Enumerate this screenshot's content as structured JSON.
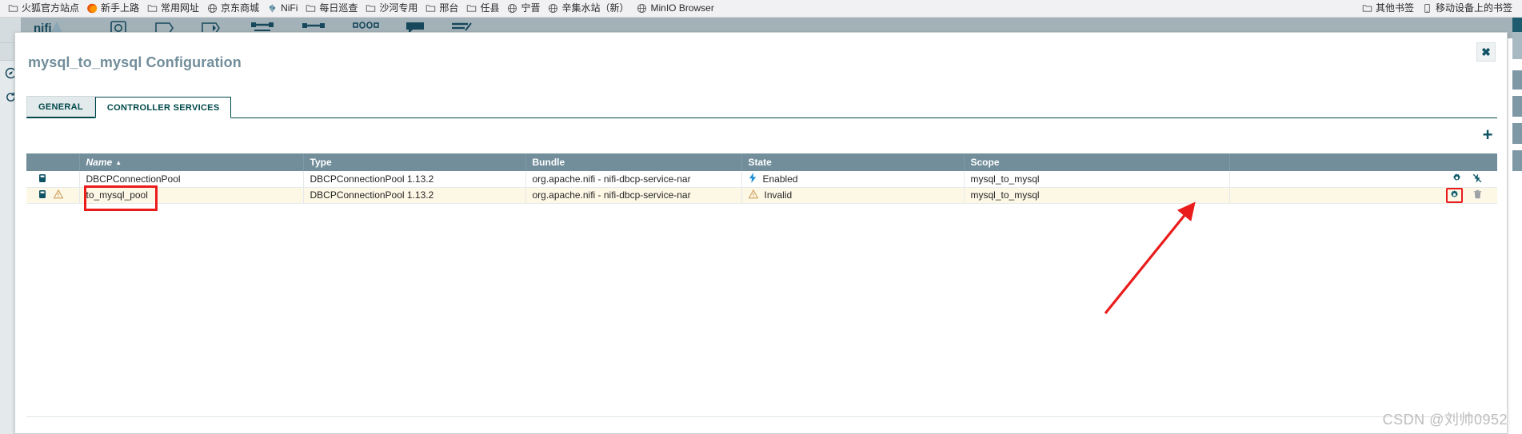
{
  "browser": {
    "bookmarks": [
      {
        "icon": "folder-icon",
        "label": "火狐官方站点"
      },
      {
        "icon": "firefox-icon",
        "label": "新手上路"
      },
      {
        "icon": "folder-icon",
        "label": "常用网址"
      },
      {
        "icon": "globe-icon",
        "label": "京东商城"
      },
      {
        "icon": "nifi-icon",
        "label": "NiFi"
      },
      {
        "icon": "folder-icon",
        "label": "每日巡查"
      },
      {
        "icon": "folder-icon",
        "label": "沙河专用"
      },
      {
        "icon": "folder-icon",
        "label": "邢台"
      },
      {
        "icon": "folder-icon",
        "label": "任县"
      },
      {
        "icon": "globe-icon",
        "label": "宁晋"
      },
      {
        "icon": "globe-icon",
        "label": "辛集水站（新）"
      },
      {
        "icon": "globe-icon",
        "label": "MinIO Browser"
      }
    ],
    "right_bookmarks": [
      {
        "icon": "folder-icon",
        "label": "其他书签"
      },
      {
        "icon": "mobile-icon",
        "label": "移动设备上的书签"
      }
    ]
  },
  "dialog": {
    "title": "mysql_to_mysql Configuration",
    "close_label": "✖",
    "tabs": [
      {
        "label": "GENERAL",
        "active": false
      },
      {
        "label": "CONTROLLER SERVICES",
        "active": true
      }
    ],
    "add_label": "+"
  },
  "table": {
    "columns": [
      {
        "key": "icons",
        "label": ""
      },
      {
        "key": "name",
        "label": "Name",
        "sorted": true,
        "sort_arrow": "▲"
      },
      {
        "key": "type",
        "label": "Type"
      },
      {
        "key": "bundle",
        "label": "Bundle"
      },
      {
        "key": "state",
        "label": "State"
      },
      {
        "key": "scope",
        "label": "Scope"
      },
      {
        "key": "actions",
        "label": ""
      }
    ],
    "rows": [
      {
        "name": "DBCPConnectionPool",
        "type": "DBCPConnectionPool 1.13.2",
        "bundle": "org.apache.nifi - nifi-dbcp-service-nar",
        "state": "Enabled",
        "state_icon": "bolt-icon",
        "scope": "mysql_to_mysql",
        "has_warning": false,
        "actions": [
          "gear-icon",
          "disable-icon"
        ]
      },
      {
        "name": "to_mysql_pool",
        "type": "DBCPConnectionPool 1.13.2",
        "bundle": "org.apache.nifi - nifi-dbcp-service-nar",
        "state": "Invalid",
        "state_icon": "warning-triangle-icon",
        "scope": "mysql_to_mysql",
        "has_warning": true,
        "actions": [
          "gear-icon",
          "trash-icon"
        ]
      }
    ]
  },
  "annotations": {
    "highlight_color": "#ea1c1c",
    "name_box_target": "to_mysql_pool",
    "arrow_target": "gear-icon-row-2"
  },
  "watermark": "CSDN @刘帅0952"
}
